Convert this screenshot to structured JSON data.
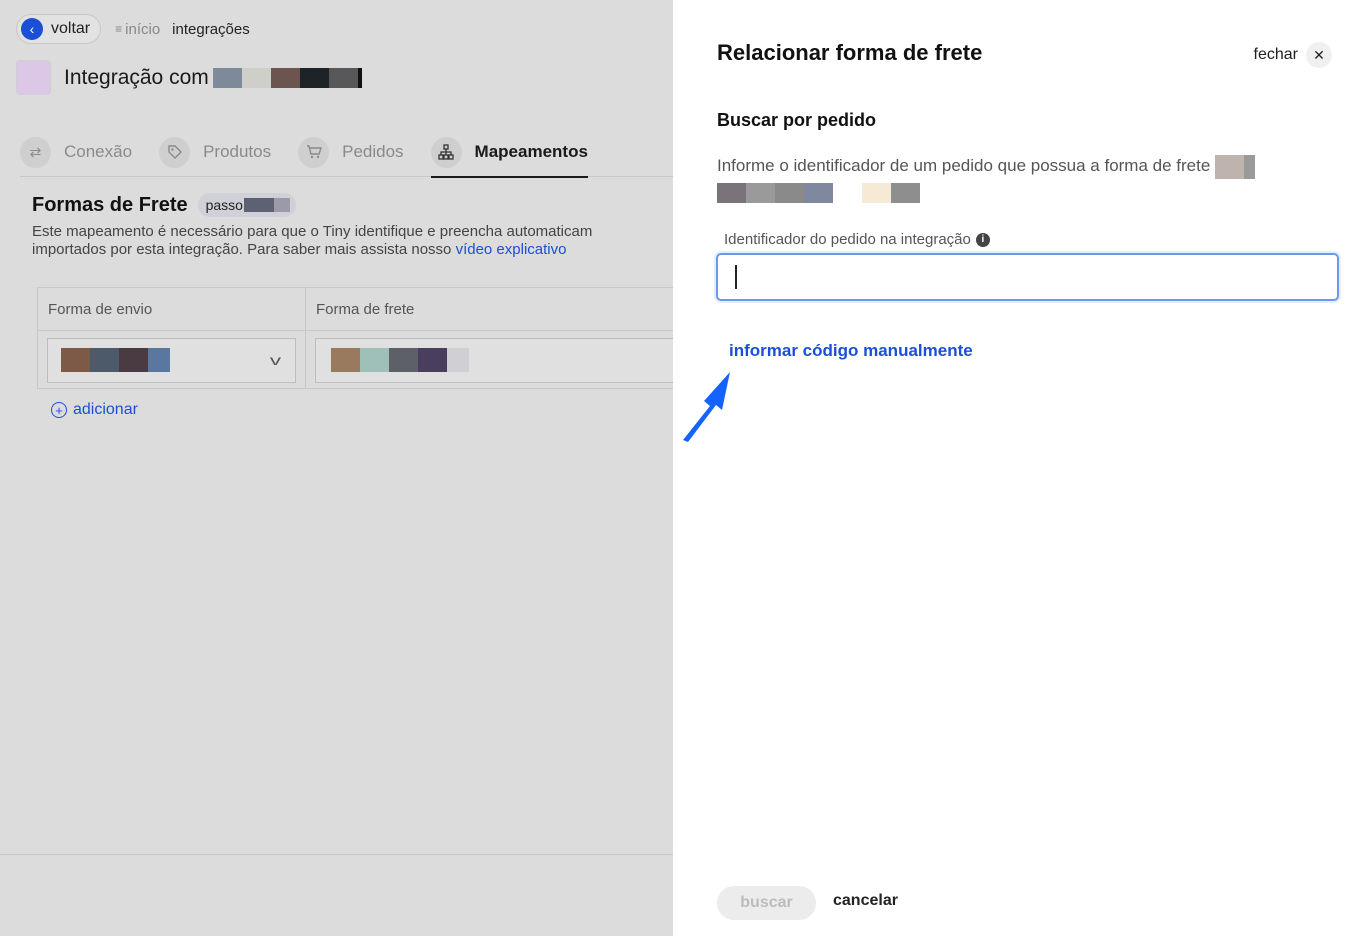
{
  "colors": {
    "accent": "#1a4fd6",
    "avatar": "#dcc7e6",
    "overlay_bg": "#dcdcdc",
    "input_focus": "#6b9be8"
  },
  "topbar": {
    "back_label": "voltar",
    "back_icon": "chevron-left-icon",
    "breadcrumb_icon": "list-icon",
    "breadcrumb_home": "início",
    "breadcrumb_current": "integrações"
  },
  "integration": {
    "title": "Integração com"
  },
  "tabs": [
    {
      "label": "Conexão",
      "icon": "swap-icon",
      "active": false
    },
    {
      "label": "Produtos",
      "icon": "tag-icon",
      "active": false
    },
    {
      "label": "Pedidos",
      "icon": "cart-icon",
      "active": false
    },
    {
      "label": "Mapeamentos",
      "icon": "sitemap-icon",
      "active": true
    }
  ],
  "section": {
    "title": "Formas de Frete",
    "step_label": "passo",
    "description_line1": "Este mapeamento é necessário para que o Tiny identifique e preencha automaticam",
    "description_line2": "importados por esta integração. Para saber mais assista nosso",
    "description_link": "vídeo explicativo"
  },
  "table": {
    "headers": [
      "Forma de envio",
      "Forma de frete"
    ],
    "add_label": "adicionar"
  },
  "drawer": {
    "title": "Relacionar forma de frete",
    "close_label": "fechar",
    "subtitle": "Buscar por pedido",
    "info_text": "Informe o identificador de um pedido que possua a forma de frete",
    "field_label": "Identificador do pedido na integração",
    "field_value": "",
    "manual_link": "informar código manualmente",
    "search_button": "buscar",
    "cancel_button": "cancelar"
  }
}
